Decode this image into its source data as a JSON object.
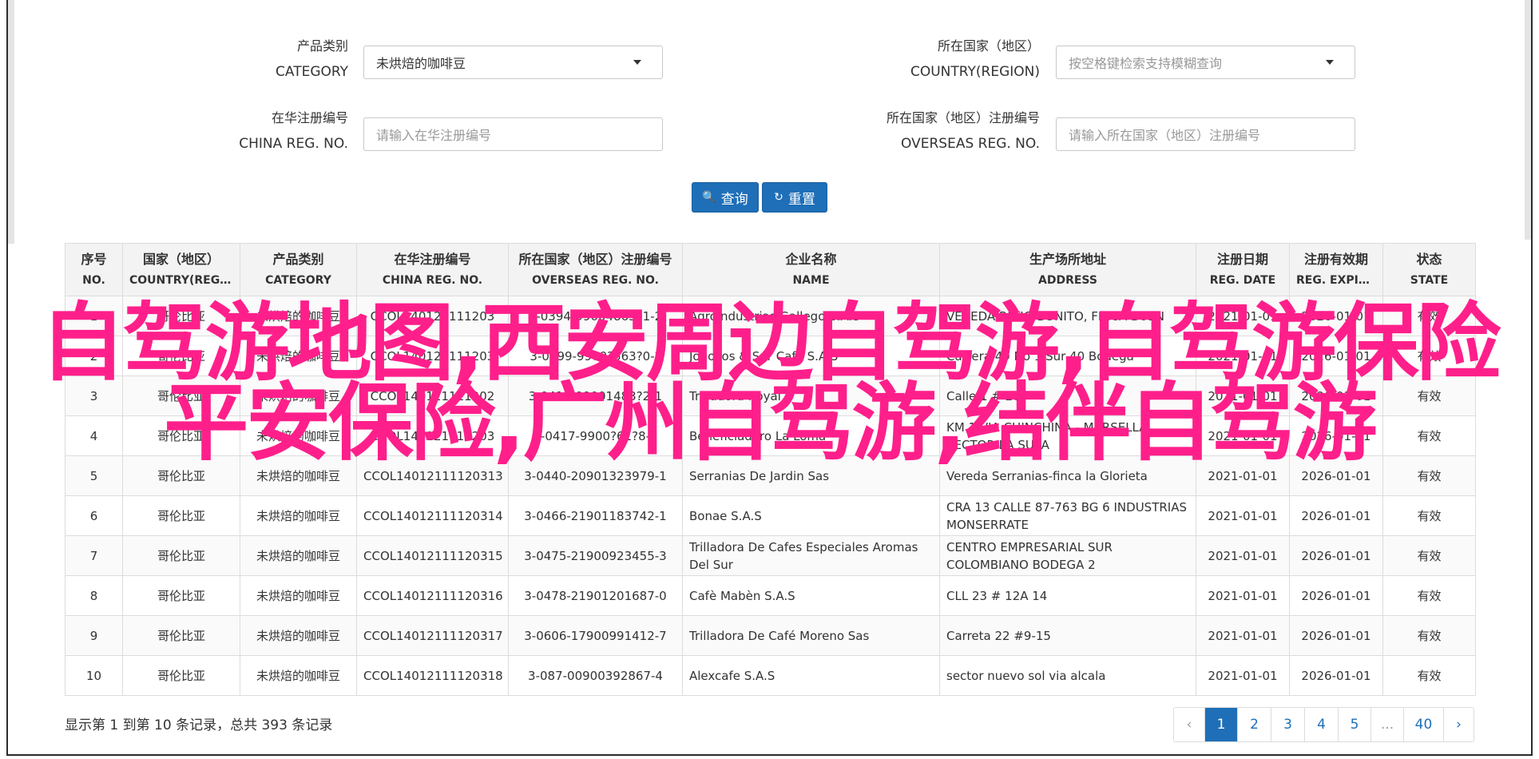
{
  "filters": {
    "category": {
      "label_zh": "产品类别",
      "label_en": "CATEGORY",
      "value": "未烘焙的咖啡豆"
    },
    "country": {
      "label_zh": "所在国家（地区）",
      "label_en": "COUNTRY(REGION)",
      "placeholder": "按空格键检索支持模糊查询"
    },
    "china_reg": {
      "label_zh": "在华注册编号",
      "label_en": "CHINA REG. NO.",
      "placeholder": "请输入在华注册编号"
    },
    "overseas_reg": {
      "label_zh": "所在国家（地区）注册编号",
      "label_en": "OVERSEAS REG. NO.",
      "placeholder": "请输入所在国家（地区）注册编号"
    }
  },
  "buttons": {
    "search": "查询",
    "reset": "重置",
    "search_icon": "search-icon",
    "reset_icon": "refresh-icon"
  },
  "table": {
    "headers": [
      {
        "zh": "序号",
        "en": "NO."
      },
      {
        "zh": "国家（地区）",
        "en": "COUNTRY(REGIO..."
      },
      {
        "zh": "产品类别",
        "en": "CATEGORY"
      },
      {
        "zh": "在华注册编号",
        "en": "CHINA REG. NO."
      },
      {
        "zh": "所在国家（地区）注册编号",
        "en": "OVERSEAS REG. NO."
      },
      {
        "zh": "企业名称",
        "en": "NAME"
      },
      {
        "zh": "生产场所地址",
        "en": "ADDRESS"
      },
      {
        "zh": "注册日期",
        "en": "REG. DATE"
      },
      {
        "zh": "注册有效期",
        "en": "REG. EXPIRE ..."
      },
      {
        "zh": "状态",
        "en": "STATE"
      }
    ],
    "rows": [
      [
        "1",
        "哥伦比亚",
        "未烘焙的咖啡豆",
        "CCOL140121111203",
        "3-0394-99004863?1-2",
        "Agroindustrias Gallego S.A.S",
        "VEREDA PATIO BONITO, FINCA BUEN",
        "2021-01-01",
        "2026-01-01",
        "有效"
      ],
      [
        "2",
        "哥伦比亚",
        "未烘焙的咖啡豆",
        "CCOL140121111203",
        "3-0399-9900?563?0-?",
        "Jonocos & Sur Cafe S.A.S",
        "Carrera 49 No 1 Sur 40 Bodega",
        "2021-01-01",
        "2026-01-01",
        "有效"
      ],
      [
        "3",
        "哥伦比亚",
        "未烘焙的咖啡豆",
        "CCOL140121111202",
        "3-0411-09001483?2-1",
        "Trilladora Royal",
        "Calle 1 # 28",
        "2021-01-01",
        "2026-01-01",
        "有效"
      ],
      [
        "4",
        "哥伦比亚",
        "未烘焙的咖啡豆",
        "CCOL140121111203",
        "3-0417-9900?61?8-1",
        "Beneficiadero La Loma",
        "KM 1 VIA CHINCHINA - MARSELLA SECTOR LA SULA",
        "2021-01-01",
        "2026-01-01",
        "有效"
      ],
      [
        "5",
        "哥伦比亚",
        "未烘焙的咖啡豆",
        "CCOL14012111120313",
        "3-0440-20901323979-1",
        "Serranias De Jardin Sas",
        "Vereda Serranias-finca la Glorieta",
        "2021-01-01",
        "2026-01-01",
        "有效"
      ],
      [
        "6",
        "哥伦比亚",
        "未烘焙的咖啡豆",
        "CCOL14012111120314",
        "3-0466-21901183742-1",
        "Bonae S.A.S",
        "CRA 13 CALLE 87-763 BG 6 INDUSTRIAS MONSERRATE",
        "2021-01-01",
        "2026-01-01",
        "有效"
      ],
      [
        "7",
        "哥伦比亚",
        "未烘焙的咖啡豆",
        "CCOL14012111120315",
        "3-0475-21900923455-3",
        "Trilladora De Cafes Especiales Aromas Del Sur",
        "CENTRO EMPRESARIAL SUR COLOMBIANO BODEGA 2",
        "2021-01-01",
        "2026-01-01",
        "有效"
      ],
      [
        "8",
        "哥伦比亚",
        "未烘焙的咖啡豆",
        "CCOL14012111120316",
        "3-0478-21901201687-0",
        "Cafè Mabèn S.A.S",
        "CLL 23 # 12A 14",
        "2021-01-01",
        "2026-01-01",
        "有效"
      ],
      [
        "9",
        "哥伦比亚",
        "未烘焙的咖啡豆",
        "CCOL14012111120317",
        "3-0606-17900991412-7",
        "Trilladora De Café Moreno Sas",
        "Carreta 22 #9-15",
        "2021-01-01",
        "2026-01-01",
        "有效"
      ],
      [
        "10",
        "哥伦比亚",
        "未烘焙的咖啡豆",
        "CCOL14012111120318",
        "3-087-00900392867-4",
        "Alexcafe S.A.S",
        "sector nuevo sol via alcala",
        "2021-01-01",
        "2026-01-01",
        "有效"
      ]
    ]
  },
  "summary": "显示第 1 到第 10 条记录，总共 393 条记录",
  "pagination": {
    "prev": "‹",
    "pages": [
      "1",
      "2",
      "3",
      "4",
      "5",
      "...",
      "40"
    ],
    "next": "›",
    "active": "1"
  },
  "overlay": {
    "line1": "自驾游地图,西安周边自驾游,自驾游保险",
    "line2": "平安保险,广州自驾游,结伴自驾游",
    "color": "#ff1f8b"
  }
}
